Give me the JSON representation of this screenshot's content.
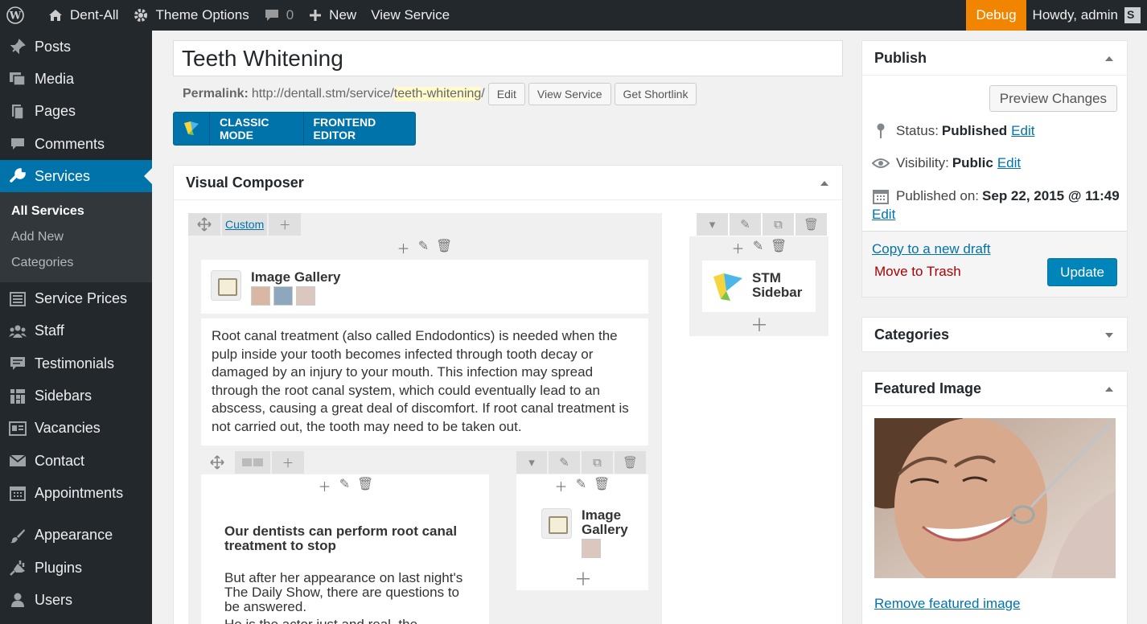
{
  "adminbar": {
    "site_name": "Dent-All",
    "theme_options": "Theme Options",
    "comments_count": "0",
    "new_label": "New",
    "view_service": "View Service",
    "debug": "Debug",
    "howdy": "Howdy, admin"
  },
  "menu": {
    "posts": "Posts",
    "media": "Media",
    "pages": "Pages",
    "comments": "Comments",
    "services": "Services",
    "submenu": {
      "all_services": "All Services",
      "add_new": "Add New",
      "categories": "Categories"
    },
    "service_prices": "Service Prices",
    "staff": "Staff",
    "testimonials": "Testimonials",
    "sidebars": "Sidebars",
    "vacancies": "Vacancies",
    "contact": "Contact",
    "appointments": "Appointments",
    "appearance": "Appearance",
    "plugins": "Plugins",
    "users": "Users"
  },
  "editor": {
    "title_value": "Teeth Whitening",
    "permalink_label": "Permalink:",
    "permalink_base": "http://dentall.stm/service/",
    "permalink_slug": "teeth-whitening",
    "permalink_trailing": "/",
    "edit_btn": "Edit",
    "view_btn": "View Service",
    "shortlink_btn": "Get Shortlink",
    "classic_mode": "CLASSIC MODE",
    "frontend_editor": "FRONTEND EDITOR"
  },
  "vc": {
    "title": "Visual Composer",
    "tab_custom": "Custom",
    "image_gallery_1": "Image Gallery",
    "stm_sidebar": "STM Sidebar",
    "text_block": "Root canal treatment (also called Endodontics) is needed when the pulp inside your tooth becomes infected through tooth decay or damaged by an injury to your mouth. This infection may spread through the root canal system, which could eventually lead to an abscess, causing a great deal of discomfort. If root canal treatment is not carried out, the tooth may need to be taken out.",
    "inner_heading": "Our dentists can perform root canal treatment to stop",
    "inner_text": "But after her appearance on last night's The Daily Show, there are questions to be answered.",
    "inner_text_cut": "He is the actor just and real, the",
    "image_gallery_2": "Image Gallery"
  },
  "publish": {
    "title": "Publish",
    "preview_btn": "Preview Changes",
    "status_label": "Status:",
    "status_value": "Published",
    "visibility_label": "Visibility:",
    "visibility_value": "Public",
    "published_label": "Published on:",
    "published_value": "Sep 22, 2015 @ 11:49",
    "edit_link": "Edit",
    "copy_draft": "Copy to a new draft",
    "trash": "Move to Trash",
    "update": "Update"
  },
  "categories": {
    "title": "Categories"
  },
  "featured": {
    "title": "Featured Image",
    "remove_link": "Remove featured image"
  }
}
